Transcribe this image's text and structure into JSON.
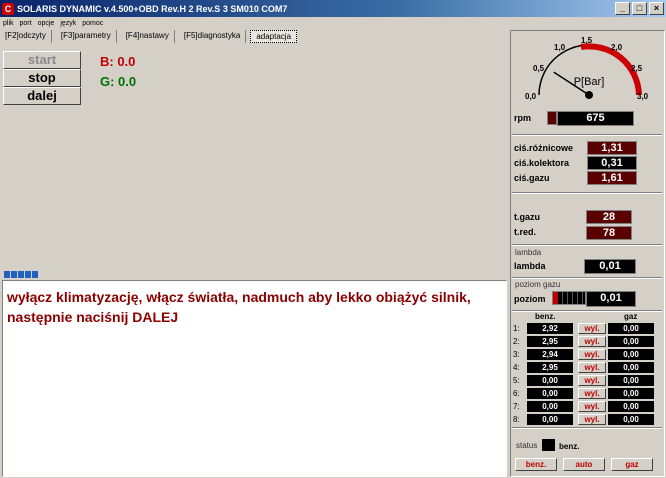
{
  "window": {
    "title": "SOLARIS DYNAMIC v.4.500+OBD Rev.H 2 Rev.S 3 SM010  COM7",
    "icon": "app-icon"
  },
  "menu": [
    "plik",
    "port",
    "opcje",
    "język",
    "pomoc"
  ],
  "tabs": [
    {
      "label": "[F2]odczyty",
      "active": false
    },
    {
      "label": "[F3]parametry",
      "active": false
    },
    {
      "label": "[F4]nastawy",
      "active": false
    },
    {
      "label": "[F5]diagnostyka",
      "active": false
    },
    {
      "label": "adaptacja",
      "active": true
    }
  ],
  "buttons": {
    "start": "start",
    "stop": "stop",
    "dalej": "dalej"
  },
  "bg": {
    "b": "B: 0.0",
    "g": "G: 0.0"
  },
  "message": "wyłącz klimatyzację, włącz światła, nadmuch aby lekko obiążyć silnik, następnie naciśnij DALEJ",
  "gauge": {
    "unit": "P[Bar]",
    "ticks": [
      "0,0",
      "0,5",
      "1,0",
      "1,5",
      "2,0",
      "2,5",
      "3,0"
    ],
    "value": 0.55
  },
  "rpm": {
    "label": "rpm",
    "value": "675"
  },
  "pressures": [
    {
      "label": "ciś.różnicowe",
      "value": "1,31"
    },
    {
      "label": "ciś.kolektora",
      "value": "0,31"
    },
    {
      "label": "ciś.gazu",
      "value": "1,61"
    }
  ],
  "temps": [
    {
      "label": "t.gazu",
      "value": "28"
    },
    {
      "label": "t.red.",
      "value": "78"
    }
  ],
  "lambda": {
    "group": "lambda",
    "label": "lambda",
    "value": "0,01"
  },
  "level": {
    "group": "poziom gazu",
    "label": "poziom",
    "value": "0,01"
  },
  "injectors": {
    "head_benz": "benz.",
    "head_gaz": "gaz",
    "rows": [
      {
        "idx": "1:",
        "benz": "2,92",
        "btn": "wyl.",
        "gaz": "0,00"
      },
      {
        "idx": "2:",
        "benz": "2,95",
        "btn": "wyl.",
        "gaz": "0,00"
      },
      {
        "idx": "3:",
        "benz": "2,94",
        "btn": "wyl.",
        "gaz": "0,00"
      },
      {
        "idx": "4:",
        "benz": "2,95",
        "btn": "wyl.",
        "gaz": "0,00"
      },
      {
        "idx": "5:",
        "benz": "0,00",
        "btn": "wyl.",
        "gaz": "0,00"
      },
      {
        "idx": "6:",
        "benz": "0,00",
        "btn": "wyl.",
        "gaz": "0,00"
      },
      {
        "idx": "7:",
        "benz": "0,00",
        "btn": "wyl.",
        "gaz": "0,00"
      },
      {
        "idx": "8:",
        "benz": "0,00",
        "btn": "wyl.",
        "gaz": "0,00"
      }
    ]
  },
  "status": {
    "label": "status",
    "value": "benz."
  },
  "modes": [
    "benz.",
    "auto",
    "gaz"
  ],
  "colors": {
    "bad": "#c00000",
    "good": "#007000",
    "display_bg": "#000000",
    "display_red": "#5a0000"
  }
}
